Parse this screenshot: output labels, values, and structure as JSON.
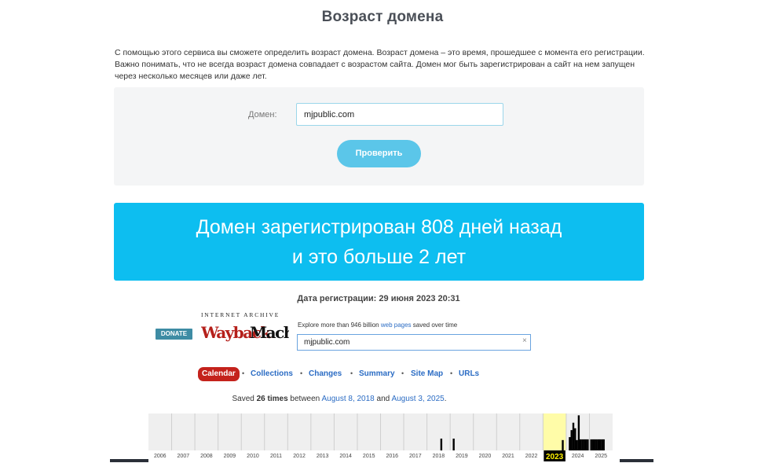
{
  "page": {
    "title": "Возраст домена",
    "intro": "С помощью этого сервиса вы сможете определить возраст домена. Возраст домена – это время, прошедшее с момента его регистрации. Важно понимать, что не всегда возраст домена совпадает с возрастом сайта. Домен мог быть зарегистрирован а сайт на нем запущен через несколько месяцев или даже лет."
  },
  "form": {
    "domain_label": "Домен:",
    "domain_value": "mjpublic.com",
    "submit_label": "Проверить"
  },
  "result": {
    "line1": "Домен зарегистрирован 808 дней назад",
    "line2": "и это больше 2 лет",
    "registration_date": "Дата регистрации: 29 июня 2023 20:31"
  },
  "wayback": {
    "donate_label": "DONATE",
    "internet_archive_label": "INTERNET ARCHIVE",
    "logo_text": "WaybackMachine",
    "explore_prefix": "Explore more than 946 billion ",
    "explore_link": "web pages",
    "explore_suffix": " saved over time",
    "search_value": "mjpublic.com",
    "clear_icon": "×",
    "tabs": [
      "Calendar",
      "Collections",
      "Changes",
      "Summary",
      "Site Map",
      "URLs"
    ],
    "saved_prefix": "Saved ",
    "saved_count": "26 times",
    "saved_between": " between ",
    "saved_first": "August 8, 2018",
    "saved_and": " and ",
    "saved_last": "August 3, 2025",
    "saved_end": "."
  },
  "timeline": {
    "years": [
      "2006",
      "2007",
      "2008",
      "2009",
      "2010",
      "2011",
      "2012",
      "2013",
      "2014",
      "2015",
      "2016",
      "2017",
      "2018",
      "2019",
      "2020",
      "2021",
      "2022",
      "2023",
      "2024",
      "2025"
    ],
    "selected_year": "2023",
    "captures": [
      {
        "year": "2018",
        "month": 7,
        "level": 0.32
      },
      {
        "year": "2019",
        "month": 1,
        "level": 0.32
      },
      {
        "year": "2023",
        "month": 10,
        "level": 0.28
      },
      {
        "year": "2024",
        "month": 1,
        "level": 0.36
      },
      {
        "year": "2024",
        "month": 2,
        "level": 0.55
      },
      {
        "year": "2024",
        "month": 3,
        "level": 0.75
      },
      {
        "year": "2024",
        "month": 4,
        "level": 0.6
      },
      {
        "year": "2024",
        "month": 5,
        "level": 0.28
      },
      {
        "year": "2024",
        "month": 6,
        "level": 0.95
      },
      {
        "year": "2024",
        "month": 7,
        "level": 0.3
      },
      {
        "year": "2024",
        "month": 8,
        "level": 0.3
      },
      {
        "year": "2024",
        "month": 9,
        "level": 0.3
      },
      {
        "year": "2024",
        "month": 10,
        "level": 0.3
      },
      {
        "year": "2024",
        "month": 11,
        "level": 0.3
      },
      {
        "year": "2025",
        "month": 0,
        "level": 0.3
      },
      {
        "year": "2025",
        "month": 1,
        "level": 0.3
      },
      {
        "year": "2025",
        "month": 2,
        "level": 0.3
      },
      {
        "year": "2025",
        "month": 3,
        "level": 0.3
      },
      {
        "year": "2025",
        "month": 4,
        "level": 0.3
      },
      {
        "year": "2025",
        "month": 5,
        "level": 0.3
      },
      {
        "year": "2025",
        "month": 6,
        "level": 0.3
      },
      {
        "year": "2025",
        "month": 7,
        "level": 0.3
      }
    ],
    "colors": {
      "bg": "#efefef",
      "selected_bg": "#fffca8",
      "bar": "#000000",
      "grid": "#cfcfcf"
    }
  }
}
